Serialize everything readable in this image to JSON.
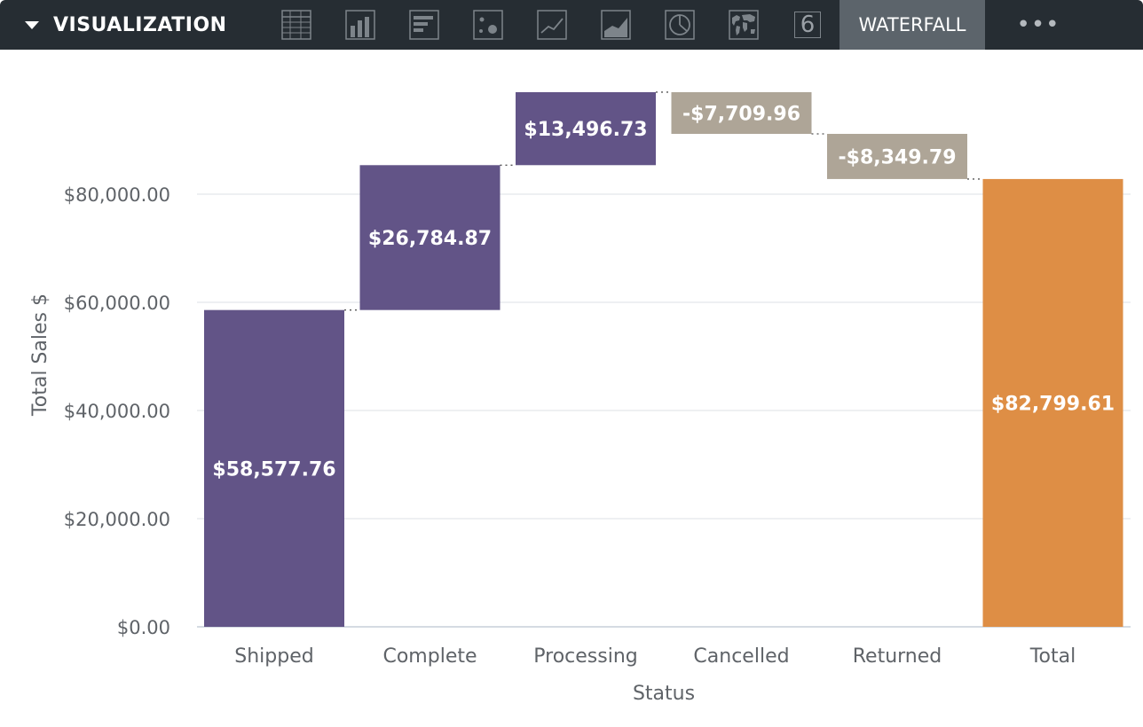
{
  "toolbar": {
    "title": "VISUALIZATION",
    "icons": [
      {
        "name": "table-icon"
      },
      {
        "name": "column-chart-icon"
      },
      {
        "name": "bar-chart-icon"
      },
      {
        "name": "scatter-chart-icon"
      },
      {
        "name": "line-chart-icon"
      },
      {
        "name": "area-chart-icon"
      },
      {
        "name": "pie-chart-icon"
      },
      {
        "name": "map-icon"
      },
      {
        "name": "single-value-icon",
        "text": "6"
      }
    ],
    "active_tab": "WATERFALL",
    "more_label": "•••"
  },
  "colors": {
    "increase": "#625487",
    "decrease": "#aea597",
    "total": "#de8e45",
    "toolbar_bg": "#262d33",
    "active_tab_bg": "#5c646b",
    "grid": "#e3e6ea",
    "axis_text": "#5f6368"
  },
  "chart_data": {
    "type": "waterfall",
    "categories": [
      "Shipped",
      "Complete",
      "Processing",
      "Cancelled",
      "Returned",
      "Total"
    ],
    "values": [
      58577.76,
      26784.87,
      13496.73,
      -7709.96,
      -8349.79,
      82799.61
    ],
    "labels": [
      "$58,577.76",
      "$26,784.87",
      "$13,496.73",
      "-$7,709.96",
      "-$8,349.79",
      "$82,799.61"
    ],
    "kinds": [
      "increase",
      "increase",
      "increase",
      "decrease",
      "decrease",
      "total"
    ],
    "xlabel": "Status",
    "ylabel": "Total Sales $",
    "ylim": [
      0,
      100000
    ],
    "yticks": [
      0,
      20000,
      40000,
      60000,
      80000
    ],
    "ytick_labels": [
      "$0.00",
      "$20,000.00",
      "$40,000.00",
      "$60,000.00",
      "$80,000.00"
    ],
    "grid": true,
    "connectors": "dotted"
  }
}
